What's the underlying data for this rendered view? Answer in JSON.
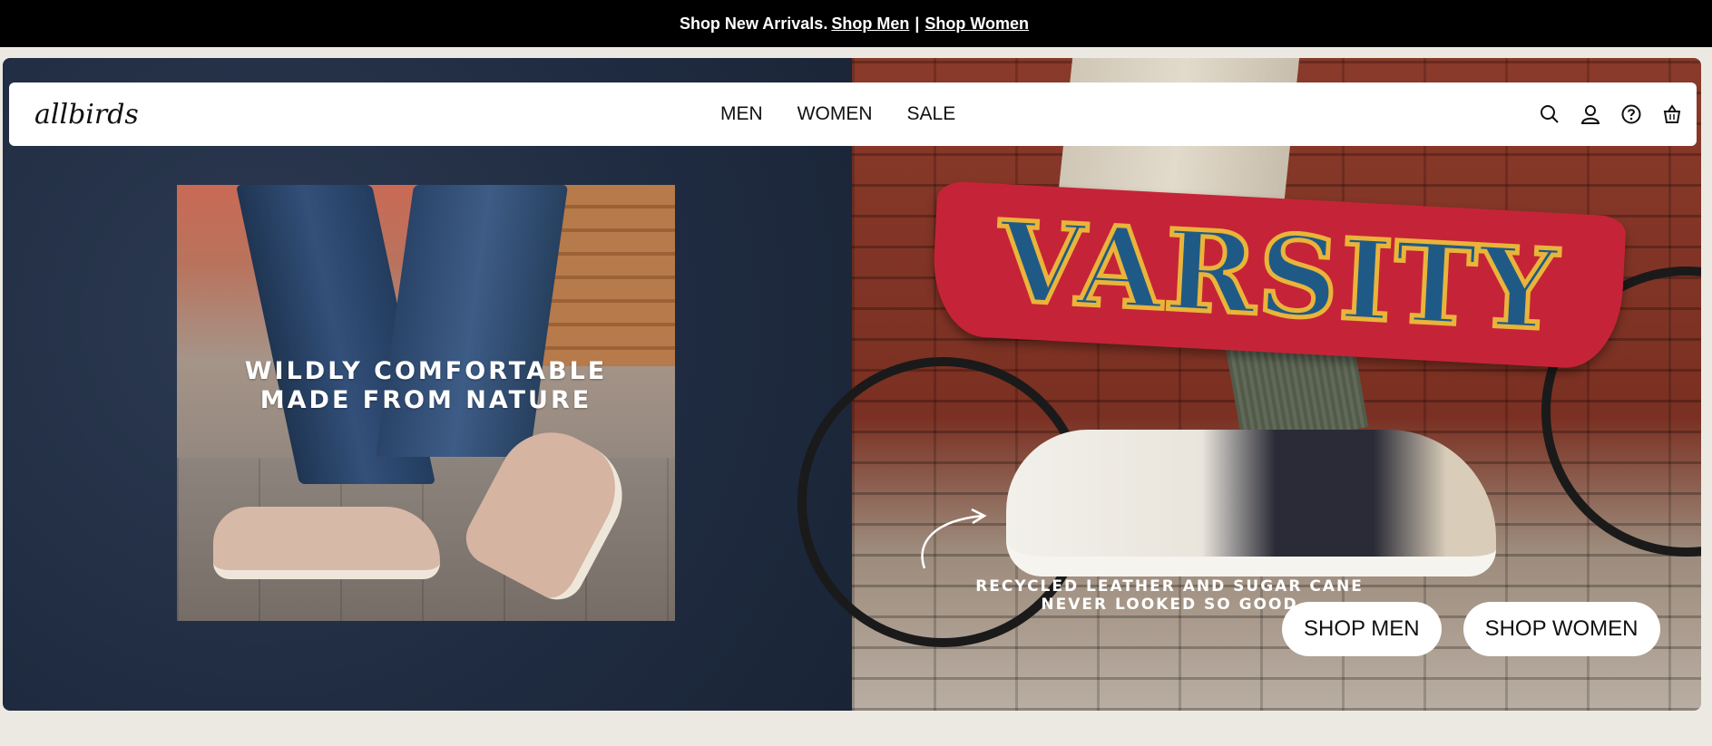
{
  "promo": {
    "text": "Shop New Arrivals.",
    "link_men": "Shop Men",
    "separator": "|",
    "link_women": "Shop Women"
  },
  "header": {
    "logo": "allbirds",
    "nav": [
      "MEN",
      "WOMEN",
      "SALE"
    ],
    "icons": [
      "search-icon",
      "account-icon",
      "help-icon",
      "cart-icon"
    ]
  },
  "hero": {
    "left_tagline_line1": "WILDLY COMFORTABLE",
    "left_tagline_line2": "MADE FROM NATURE",
    "patch_text": "VARSITY",
    "sub_line1": "RECYCLED LEATHER AND SUGAR CANE",
    "sub_line2": "NEVER LOOKED SO GOOD",
    "cta_men": "SHOP MEN",
    "cta_women": "SHOP WOMEN"
  },
  "colors": {
    "promo_bg": "#000000",
    "page_bg": "#ece9e3",
    "left_panel": "#1f2b40",
    "patch_red": "#c52438",
    "patch_blue": "#1f5a87",
    "patch_gold": "#e9b43a"
  }
}
